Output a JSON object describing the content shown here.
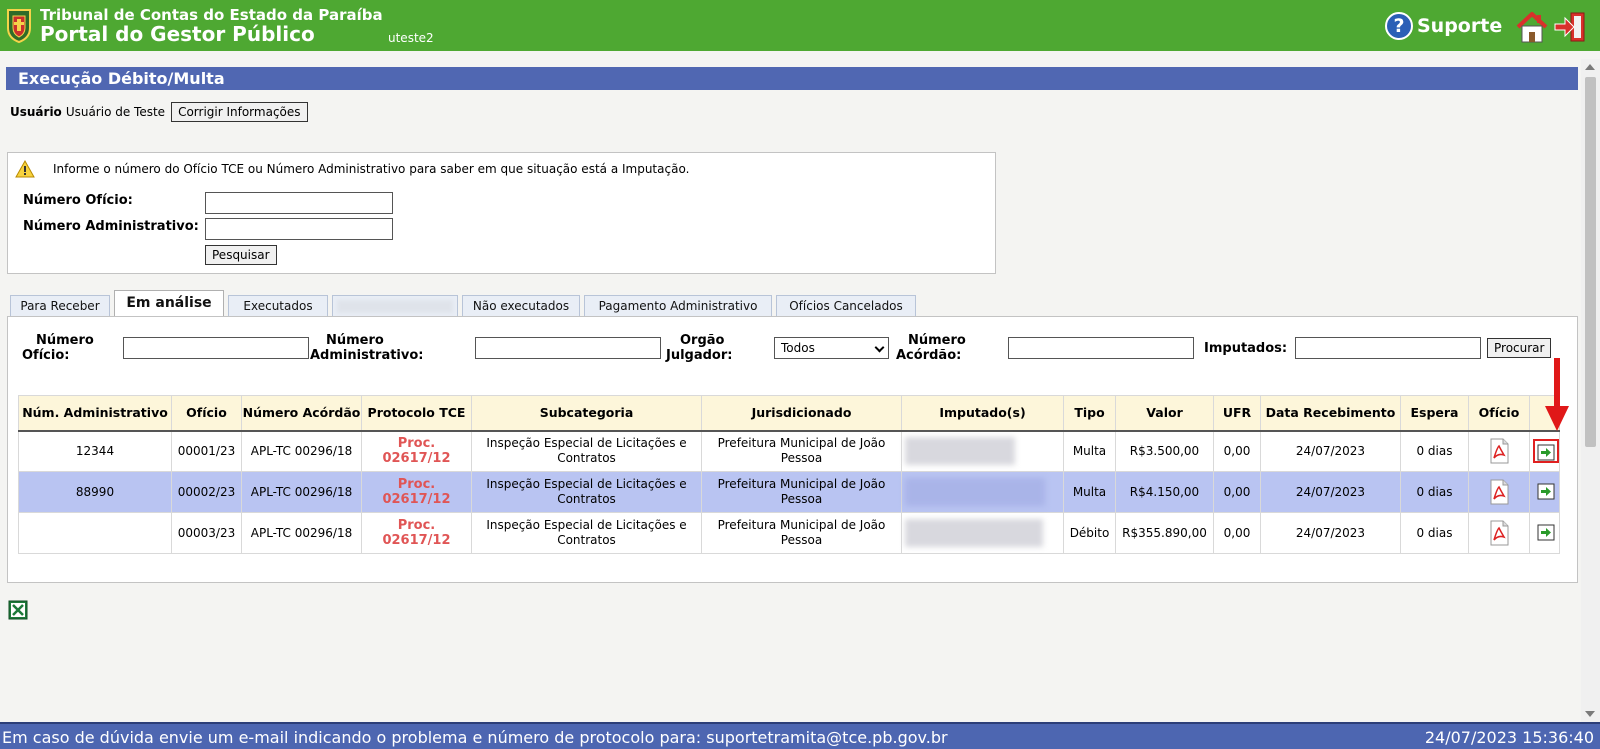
{
  "header": {
    "brand_line1": "Tribunal de Contas do Estado da Paraíba",
    "brand_line2": "Portal do Gestor Público",
    "username": "uteste2",
    "support_label": "Suporte",
    "support_icon": "question-mark-icon",
    "home_icon": "home-icon",
    "logout_icon": "exit-icon"
  },
  "page": {
    "title": "Execução Débito/Multa",
    "user_label": "Usuário",
    "user_name": "Usuário de Teste",
    "fix_info_button": "Corrigir Informações"
  },
  "lookup": {
    "info_text": "Informe o número do Ofício TCE ou Número Administrativo para saber em que situação está a Imputação.",
    "oficio_label": "Número Ofício:",
    "oficio_value": "",
    "admin_label": "Número Administrativo:",
    "admin_value": "",
    "search_button": "Pesquisar"
  },
  "tabs": [
    {
      "label": "Para Receber",
      "active": false
    },
    {
      "label": "Em análise",
      "active": true
    },
    {
      "label": "Executados",
      "active": false
    },
    {
      "label": "",
      "active": false,
      "blurred": true
    },
    {
      "label": "Não executados",
      "active": false
    },
    {
      "label": "Pagamento Administrativo",
      "active": false
    },
    {
      "label": "Ofícios Cancelados",
      "active": false
    }
  ],
  "filters": {
    "oficio_label_1": "Número",
    "oficio_label_2": "Ofício:",
    "oficio_value": "",
    "admin_label_1": "Número",
    "admin_label_2": "Administrativo:",
    "admin_value": "",
    "orgao_label_1": "Orgão",
    "orgao_label_2": "Julgador:",
    "orgao_selected": "Todos",
    "acordao_label_1": "Número",
    "acordao_label_2": "Acórdão:",
    "acordao_value": "",
    "imputados_label": "Imputados:",
    "imputados_value": "",
    "search_button": "Procurar"
  },
  "table": {
    "columns": [
      "Núm. Administrativo",
      "Ofício",
      "Número Acórdão",
      "Protocolo TCE",
      "Subcategoria",
      "Jurisdicionado",
      "Imputado(s)",
      "Tipo",
      "Valor",
      "UFR",
      "Data Recebimento",
      "Espera",
      "Ofício",
      ""
    ],
    "rows": [
      {
        "num_admin": "12344",
        "oficio": "00001/23",
        "acordao": "APL-TC 00296/18",
        "protocolo": "Proc. 02617/12",
        "subcategoria": "Inspeção Especial de Licitações e Contratos",
        "jurisdicionado": "Prefeitura Municipal de João Pessoa",
        "tipo": "Multa",
        "valor": "R$3.500,00",
        "ufr": "0,00",
        "data": "24/07/2023",
        "espera": "0 dias"
      },
      {
        "num_admin": "88990",
        "oficio": "00002/23",
        "acordao": "APL-TC 00296/18",
        "protocolo": "Proc. 02617/12",
        "subcategoria": "Inspeção Especial de Licitações e Contratos",
        "jurisdicionado": "Prefeitura Municipal de João Pessoa",
        "tipo": "Multa",
        "valor": "R$4.150,00",
        "ufr": "0,00",
        "data": "24/07/2023",
        "espera": "0 dias"
      },
      {
        "num_admin": "",
        "oficio": "00003/23",
        "acordao": "APL-TC 00296/18",
        "protocolo": "Proc. 02617/12",
        "subcategoria": "Inspeção Especial de Licitações e Contratos",
        "jurisdicionado": "Prefeitura Municipal de João Pessoa",
        "tipo": "Débito",
        "valor": "R$355.890,00",
        "ufr": "0,00",
        "data": "24/07/2023",
        "espera": "0 dias"
      }
    ]
  },
  "colors": {
    "header_green": "#4ea832",
    "title_blue": "#5067b2",
    "selected_row": "#b9c4f2",
    "table_header": "#fdf6da",
    "protocol_red": "#e05555",
    "highlight_red": "#e02020"
  },
  "footer": {
    "message": "Em caso de dúvida envie um e-mail indicando o problema e número de protocolo para: suportetramita@tce.pb.gov.br",
    "timestamp": "24/07/2023 15:36:40"
  }
}
